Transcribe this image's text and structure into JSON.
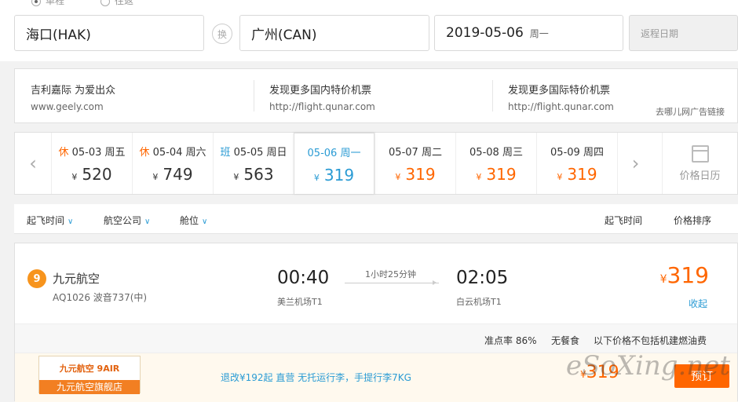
{
  "trip_type": {
    "one_way": "单程",
    "round": "往返"
  },
  "search": {
    "from": "海口(HAK)",
    "swap": "换",
    "to": "广州(CAN)",
    "date": "2019-05-06",
    "date_weekday": "周一",
    "return_placeholder": "返程日期"
  },
  "ads": {
    "items": [
      {
        "title": "吉利嘉际 为爱出众",
        "url": "www.geely.com"
      },
      {
        "title": "发现更多国内特价机票",
        "url": "http://flight.qunar.com"
      },
      {
        "title": "发现更多国际特价机票",
        "url": "http://flight.qunar.com"
      }
    ],
    "note": "去哪儿网广告链接"
  },
  "dates": {
    "items": [
      {
        "tag": "休",
        "date": "05-03 周五",
        "yen": "¥",
        "price": "520"
      },
      {
        "tag": "休",
        "date": "05-04 周六",
        "yen": "¥",
        "price": "749"
      },
      {
        "tag": "班",
        "date": "05-05 周日",
        "yen": "¥",
        "price": "563"
      },
      {
        "tag": "",
        "date": "05-06 周一",
        "yen": "¥",
        "price": "319"
      },
      {
        "tag": "",
        "date": "05-07 周二",
        "yen": "¥",
        "price": "319"
      },
      {
        "tag": "",
        "date": "05-08 周三",
        "yen": "¥",
        "price": "319"
      },
      {
        "tag": "",
        "date": "05-09 周四",
        "yen": "¥",
        "price": "319"
      }
    ],
    "calendar_label": "价格日历"
  },
  "filters": {
    "depart_time": "起飞时间",
    "airline": "航空公司",
    "cabin": "舱位",
    "sort_time": "起飞时间",
    "sort_price": "价格排序"
  },
  "flight": {
    "airline": "九元航空",
    "flight_no": "AQ1026 波音737(中)",
    "dep_time": "00:40",
    "dep_airport": "美兰机场T1",
    "duration": "1小时25分钟",
    "arr_time": "02:05",
    "arr_airport": "白云机场T1",
    "yen": "¥",
    "price": "319",
    "collapse": "收起",
    "punctuality": "准点率 86%",
    "meal": "无餐食",
    "tax_note": "以下价格不包括机建燃油费"
  },
  "offer": {
    "logo_top": "九元航空 9AIR",
    "logo_bottom": "九元航空旗舰店",
    "desc": "退改¥192起   直营   无托运行李，手提行李7KG",
    "yen": "¥",
    "price": "319",
    "book": "预订"
  },
  "watermark": "eSoXing.net"
}
